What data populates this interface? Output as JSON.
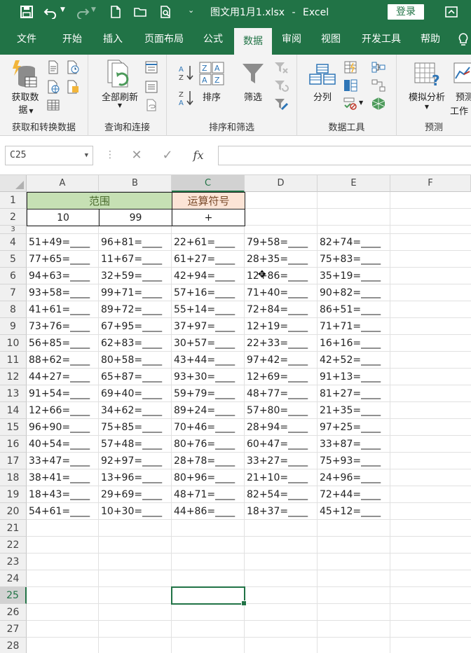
{
  "titlebar": {
    "filename": "图文用1月1.xlsx",
    "separator": "-",
    "app": "Excel",
    "login_label": "登录"
  },
  "tabs": [
    {
      "label": "文件",
      "active": false
    },
    {
      "label": "开始",
      "active": false
    },
    {
      "label": "插入",
      "active": false
    },
    {
      "label": "页面布局",
      "active": false
    },
    {
      "label": "公式",
      "active": false
    },
    {
      "label": "数据",
      "active": true
    },
    {
      "label": "审阅",
      "active": false
    },
    {
      "label": "视图",
      "active": false
    },
    {
      "label": "开发工具",
      "active": false
    },
    {
      "label": "帮助",
      "active": false
    }
  ],
  "ribbon": {
    "groups": {
      "get_transform": "获取和转换数据",
      "query_connect": "查询和连接",
      "sort_filter": "排序和筛选",
      "data_tools": "数据工具",
      "forecast": "预测"
    },
    "buttons": {
      "get_data_line1": "获取数",
      "get_data_line2": "据",
      "refresh_all": "全部刷新",
      "sort": "排序",
      "filter": "筛选",
      "split": "分列",
      "what_if": "模拟分析",
      "forecast_sheet_line1": "预测",
      "forecast_sheet_line2": "工作"
    }
  },
  "formula_bar": {
    "name_box": "C25",
    "fx_label": "fx",
    "formula": ""
  },
  "columns": [
    "A",
    "B",
    "C",
    "D",
    "E",
    "F"
  ],
  "selected_column": "C",
  "rows": [
    "1",
    "2",
    "3",
    "4",
    "5",
    "6",
    "7",
    "8",
    "9",
    "10",
    "11",
    "12",
    "13",
    "14",
    "15",
    "16",
    "17",
    "18",
    "19",
    "20",
    "21",
    "22",
    "23",
    "24",
    "25",
    "26",
    "27",
    "28"
  ],
  "selected_row": "25",
  "header": {
    "range_label": "范围",
    "operator_label": "运算符号",
    "min": "10",
    "max": "99",
    "operator": "+"
  },
  "problems": [
    [
      "51+49=____",
      "96+81=____",
      "22+61=____",
      "79+58=____",
      "82+74=____"
    ],
    [
      "77+65=____",
      "11+67=____",
      "61+27=____",
      "28+35=____",
      "75+83=____"
    ],
    [
      "94+63=____",
      "32+59=____",
      "42+94=____",
      "12+86=____",
      "35+19=____"
    ],
    [
      "93+58=____",
      "99+71=____",
      "57+16=____",
      "71+40=____",
      "90+82=____"
    ],
    [
      "41+61=____",
      "89+72=____",
      "55+14=____",
      "72+84=____",
      "86+51=____"
    ],
    [
      "73+76=____",
      "67+95=____",
      "37+97=____",
      "12+19=____",
      "71+71=____"
    ],
    [
      "56+85=____",
      "62+83=____",
      "30+57=____",
      "22+33=____",
      "16+16=____"
    ],
    [
      "88+62=____",
      "80+58=____",
      "43+44=____",
      "97+42=____",
      "42+52=____"
    ],
    [
      "44+27=____",
      "65+87=____",
      "93+30=____",
      "12+69=____",
      "91+13=____"
    ],
    [
      "91+54=____",
      "69+40=____",
      "59+79=____",
      "48+77=____",
      "81+27=____"
    ],
    [
      "12+66=____",
      "34+62=____",
      "89+24=____",
      "57+80=____",
      "21+35=____"
    ],
    [
      "96+90=____",
      "75+85=____",
      "70+46=____",
      "28+94=____",
      "97+25=____"
    ],
    [
      "40+54=____",
      "57+48=____",
      "80+76=____",
      "60+47=____",
      "33+87=____"
    ],
    [
      "33+47=____",
      "92+97=____",
      "28+78=____",
      "33+27=____",
      "75+93=____"
    ],
    [
      "38+41=____",
      "13+96=____",
      "80+96=____",
      "21+10=____",
      "24+96=____"
    ],
    [
      "18+43=____",
      "29+69=____",
      "48+71=____",
      "82+54=____",
      "72+44=____"
    ],
    [
      "54+61=____",
      "10+30=____",
      "44+86=____",
      "18+37=____",
      "45+12=____"
    ]
  ],
  "colors": {
    "excel_green": "#217346",
    "range_fill": "#c6e0b4",
    "operator_fill": "#fce4d6"
  }
}
